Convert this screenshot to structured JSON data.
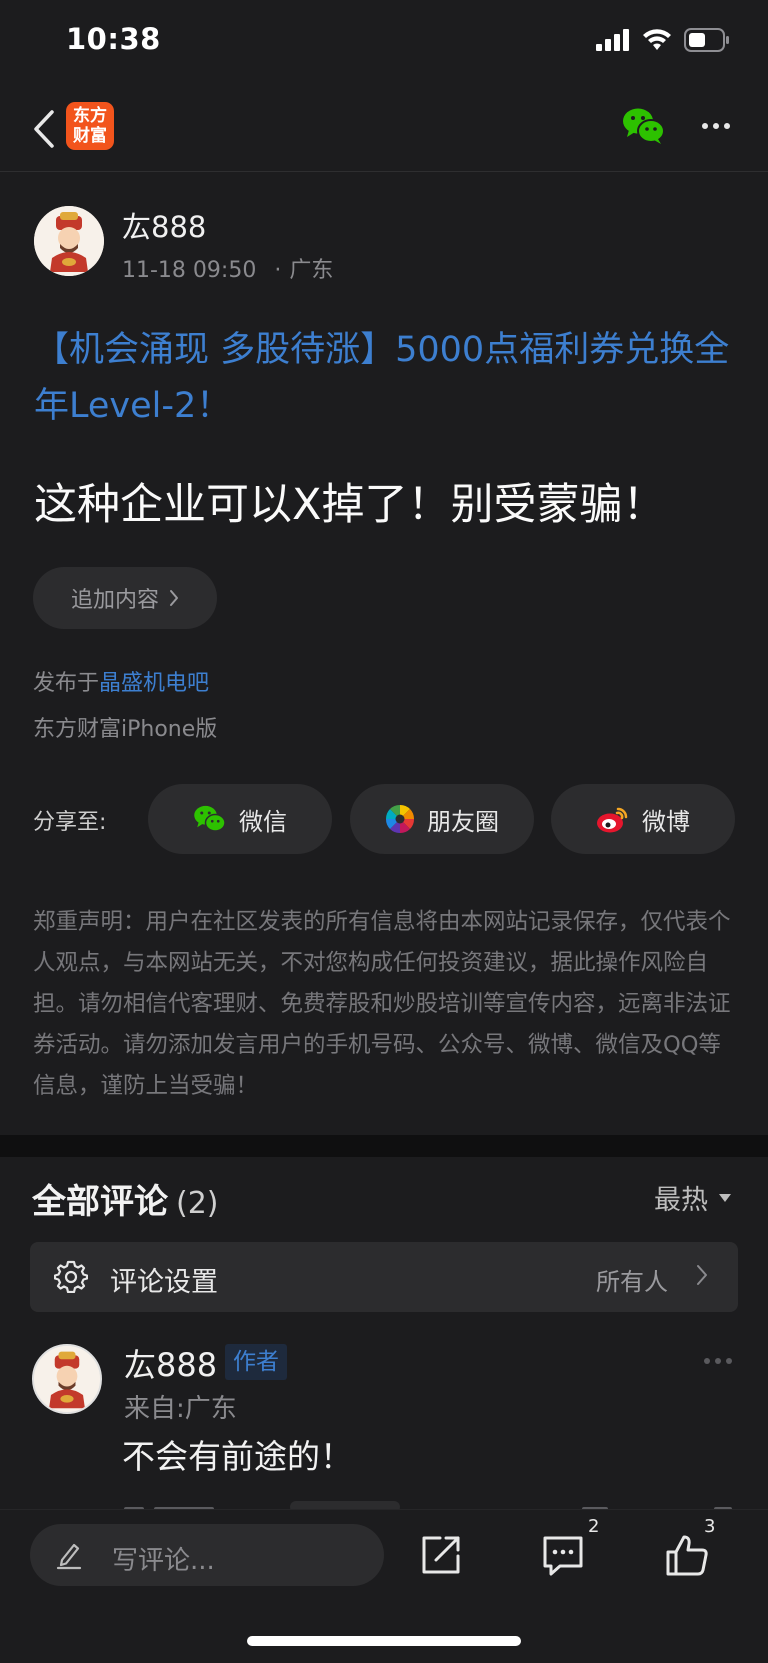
{
  "status_bar": {
    "time": "10:38"
  },
  "nav": {
    "logo_line1": "东方",
    "logo_line2": "财富"
  },
  "post": {
    "author": "厷888",
    "date": "11-18 09:50",
    "location_sep": "·",
    "location": "广东",
    "promo_text": "【机会涌现 多股待涨】5000点福利券兑换全年Level-2！",
    "title": "这种企业可以X掉了！别受蒙骗！",
    "add_content_label": "追加内容",
    "published_prefix": "发布于",
    "published_bar": "晶盛机电吧",
    "platform": "东方财富iPhone版"
  },
  "share": {
    "label": "分享至:",
    "wechat": "微信",
    "moments": "朋友圈",
    "weibo": "微博"
  },
  "disclaimer": "郑重声明：用户在社区发表的所有信息将由本网站记录保存，仅代表个人观点，与本网站无关，不对您构成任何投资建议，据此操作风险自担。请勿相信代客理财、免费荐股和炒股培训等宣传内容，远离非法证券活动。请勿添加发言用户的手机号码、公众号、微博、微信及QQ等信息，谨防上当受骗！",
  "comments": {
    "header": "全部评论",
    "count": "(2)",
    "sort_label": "最热",
    "settings_label": "评论设置",
    "settings_value": "所有人",
    "items": [
      {
        "author": "厷888",
        "badge": "作者",
        "origin": "来自:广东",
        "text": "不会有前途的！"
      }
    ]
  },
  "bottom_bar": {
    "compose_placeholder": "写评论...",
    "comment_count": "2",
    "like_count": "3"
  },
  "colors": {
    "background": "#1c1c1e",
    "link_blue": "#3d7fd0",
    "brand_orange": "#f2541c",
    "wechat_green": "#2dc100"
  }
}
